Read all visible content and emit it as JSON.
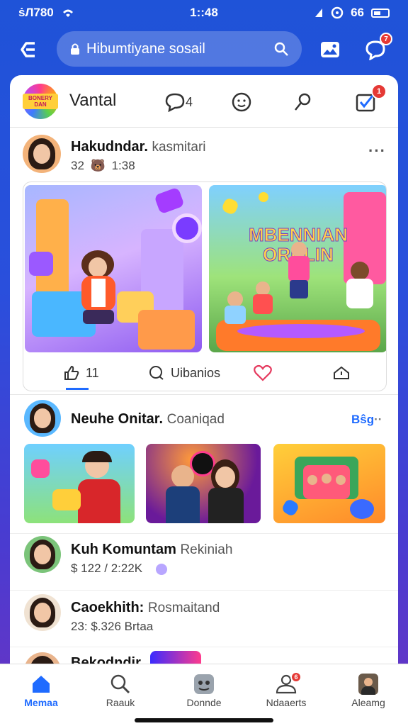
{
  "status_bar": {
    "left_text": "ṡЛ780",
    "time": "1::48",
    "right_text": "66"
  },
  "search": {
    "placeholder": "Hibumtiyane sosail"
  },
  "header": {
    "group_name": "Vantal",
    "comment_count": "4",
    "notification_badge": "7",
    "check_badge": "1",
    "group_logo_text": "BONERY DAN"
  },
  "post1": {
    "author": "Hakudndar.",
    "author_sub": "kasmitari",
    "meta_count": "32",
    "meta_time": "1:38",
    "image_b_title": "MBENNIAN ORDLIN",
    "like_count": "11",
    "comment_label": "Uibanios"
  },
  "post2": {
    "author": "Neuhe Onitar.",
    "author_sub": "Coaniqad",
    "meta": "Bŝg"
  },
  "list": [
    {
      "name": "Kuh Komuntam",
      "sub": "Rekiniah",
      "meta": "$ 122  /  2:22K"
    },
    {
      "name": "Caoekhith:",
      "sub": "Rosmaitand",
      "meta": "23: $.326 Brtaa"
    },
    {
      "name": "Bekodndir",
      "sub": "",
      "meta": ""
    }
  ],
  "bottom_nav": [
    {
      "label": "Memaa",
      "active": true
    },
    {
      "label": "Raauk",
      "active": false
    },
    {
      "label": "Donnde",
      "active": false
    },
    {
      "label": "Ndaaerts",
      "active": false
    },
    {
      "label": "Aleamg",
      "active": false
    }
  ],
  "bottom_nav_badge": "6",
  "colors": {
    "brand": "#1f53d8",
    "accent": "#1f6bff",
    "badge": "#e53935",
    "heart": "#e5395e"
  },
  "icons": [
    "back-icon",
    "lock-icon",
    "image-icon",
    "chat-icon",
    "comment-icon",
    "emoji-icon",
    "pin-icon",
    "check-icon",
    "like-icon",
    "heart-icon",
    "share-icon",
    "home-icon",
    "search-icon",
    "game-icon",
    "community-icon",
    "profile-icon"
  ]
}
